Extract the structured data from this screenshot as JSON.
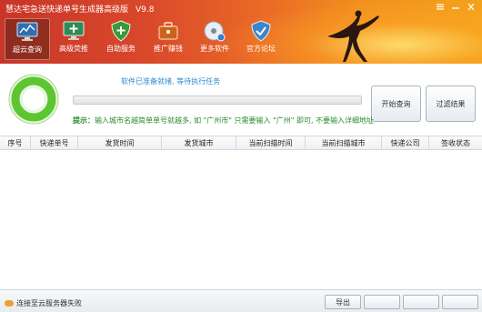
{
  "window": {
    "title": "慧达宅急送快递单号生成器高级版",
    "version": "V9.8"
  },
  "nav": [
    {
      "label": "超云查询",
      "icon": "monitor-chart-icon",
      "active": true
    },
    {
      "label": "高级荧推",
      "icon": "screen-plus-icon",
      "active": false
    },
    {
      "label": "自助服务",
      "icon": "shield-plus-icon",
      "active": false
    },
    {
      "label": "推广赚钱",
      "icon": "briefcase-icon",
      "active": false
    },
    {
      "label": "更多软件",
      "icon": "disc-icon",
      "active": false
    },
    {
      "label": "官方论坛",
      "icon": "shield-check-icon",
      "active": false
    }
  ],
  "status": {
    "message": "软件已准备就绪, 等待执行任务",
    "progress": 0,
    "tip_lead": "提示：",
    "tip_text": "输入城市名越简单单号就越多, 如 \"广州市\" 只需要输入 \"广州\" 即可, 不要输入详细地址"
  },
  "buttons": {
    "start": "开始查询",
    "filter": "过滤结果"
  },
  "table": {
    "columns": [
      "序号",
      "快递单号",
      "发货时间",
      "发货城市",
      "当前扫描时间",
      "当前扫描城市",
      "快递公司",
      "签收状态"
    ],
    "rows": []
  },
  "footer": {
    "connection": "连接至云服务器失败",
    "export": "导出"
  },
  "colors": {
    "header_left": "#c8352a",
    "header_right": "#f3a21b",
    "ring_green": "#5dc531",
    "status_blue": "#2a8ad0",
    "tip_green": "#2a8a2a"
  }
}
